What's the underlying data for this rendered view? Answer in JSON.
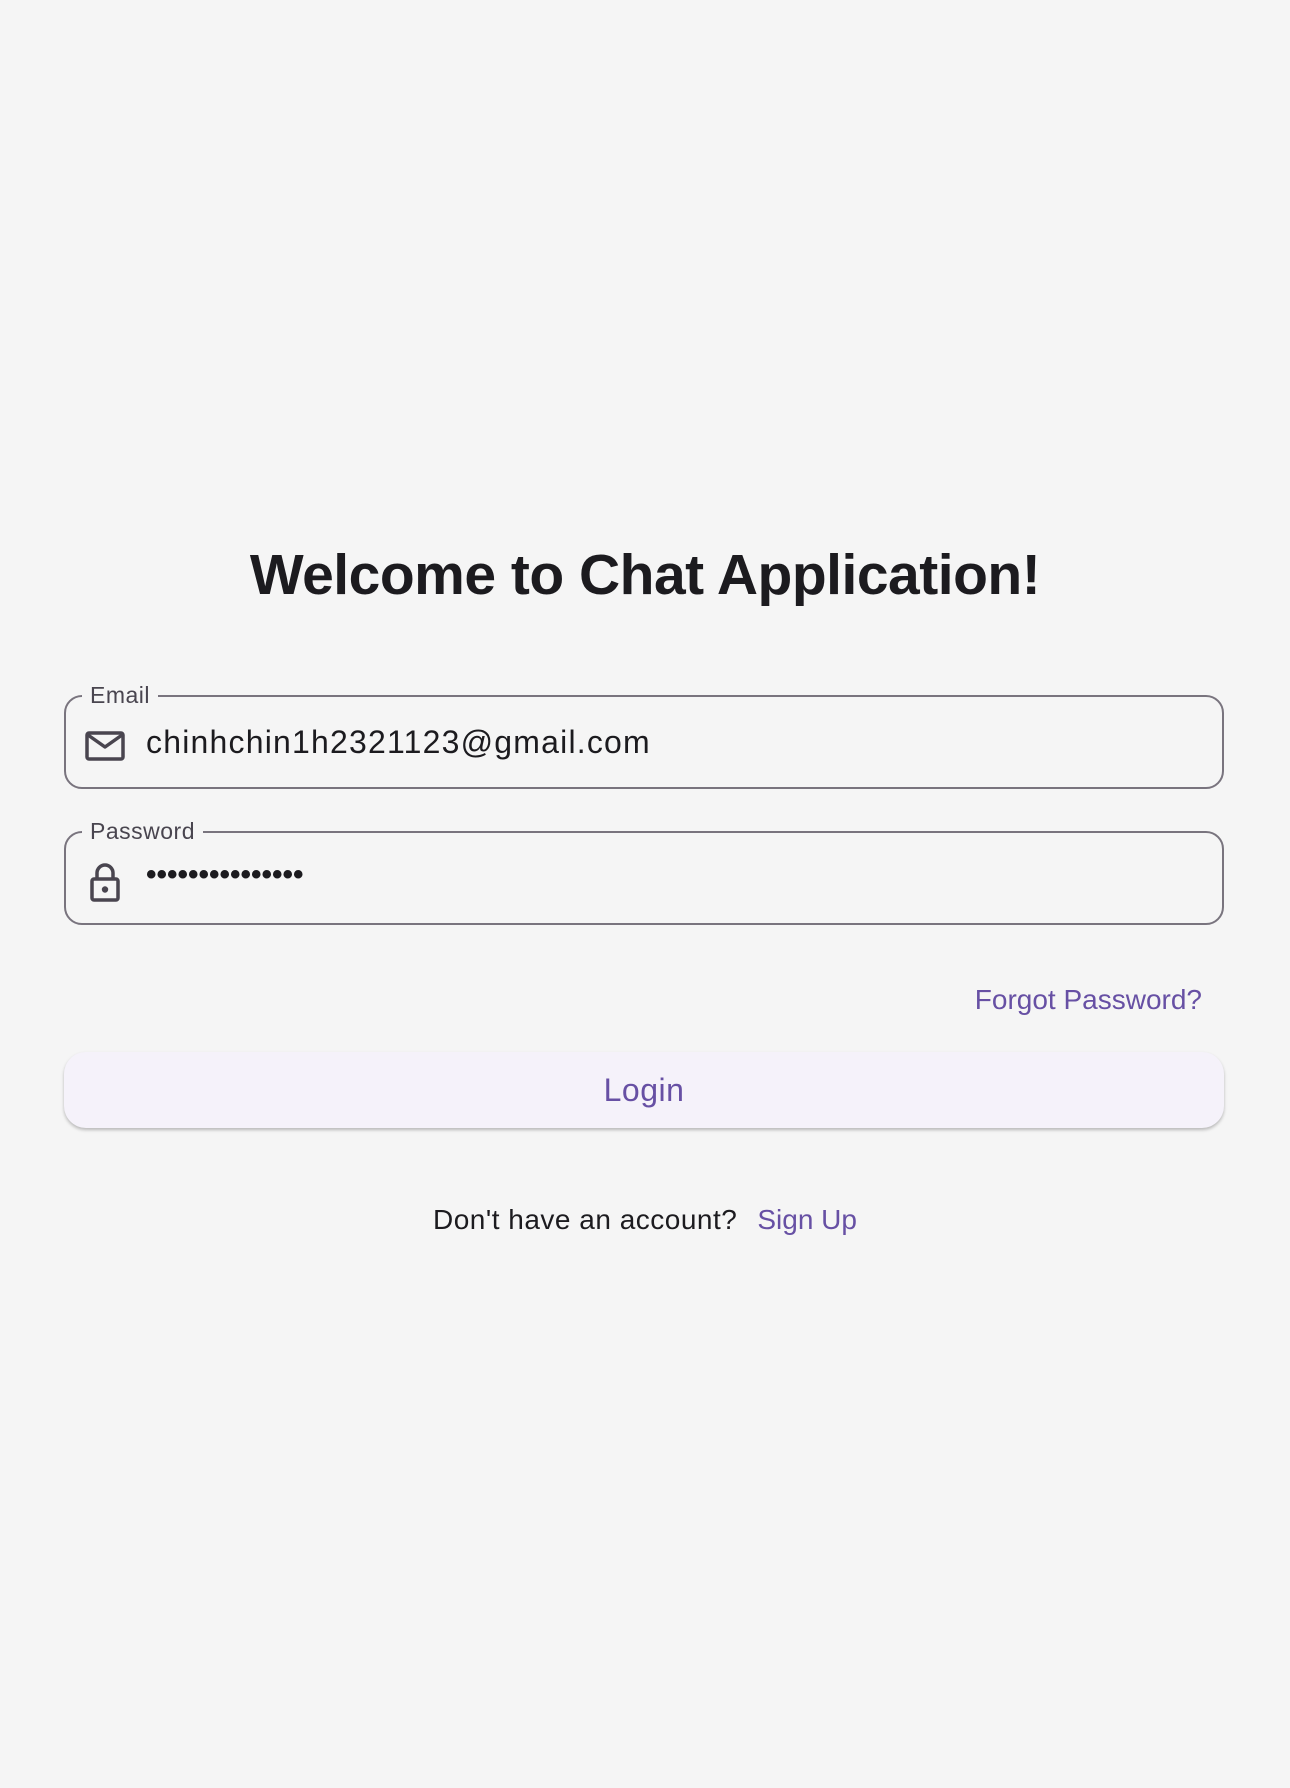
{
  "page": {
    "title": "Welcome to Chat Application!"
  },
  "email": {
    "label": "Email",
    "value": "chinhchin1h2321123@gmail.com",
    "icon": "mail-icon"
  },
  "password": {
    "label": "Password",
    "value": "•••••••••••••••",
    "icon": "lock-icon"
  },
  "links": {
    "forgot_password": "Forgot Password?",
    "signup_prompt": "Don't have an account?",
    "signup": "Sign Up"
  },
  "buttons": {
    "login": "Login"
  },
  "colors": {
    "background": "#f5f5f5",
    "accent": "#6750a4",
    "outline": "#79747e",
    "text": "#1c1b1f",
    "button_surface": "#f5f2fa"
  }
}
